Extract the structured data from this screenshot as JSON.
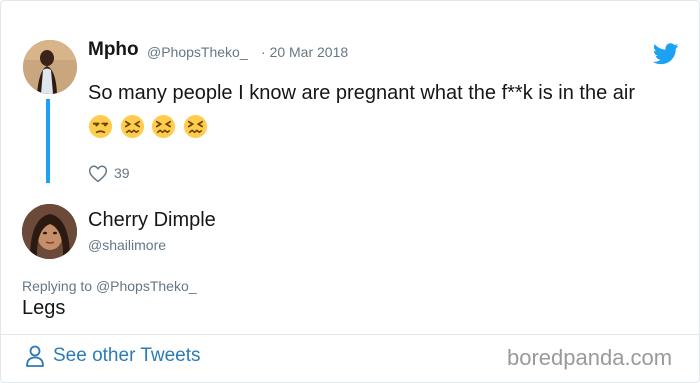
{
  "tweet": {
    "author_name": "Mpho",
    "handle": "@PhopsTheko_",
    "separator": "·",
    "date": "20 Mar 2018",
    "text": "So many people I know are pregnant what the f**k is in the air",
    "emojis": [
      "unamused-face",
      "confounded-face",
      "confounded-face",
      "confounded-face"
    ],
    "likes": "39",
    "accent_color": "#1da1f2"
  },
  "reply": {
    "author_name": "Cherry Dimple",
    "handle": "@shailimore",
    "replying_prefix": "Replying to",
    "replying_handle": "@PhopsTheko_",
    "text": "Legs"
  },
  "footer": {
    "see_other_label": "See other Tweets",
    "link_color": "#2b7bb9",
    "watermark": "boredpanda.com"
  }
}
